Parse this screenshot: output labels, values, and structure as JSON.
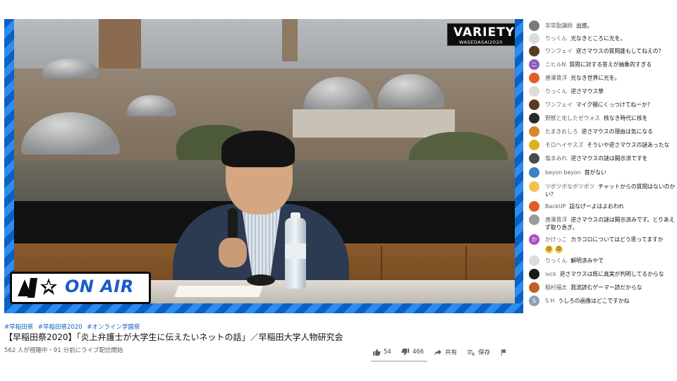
{
  "overlay": {
    "variety_title": "VARIETY",
    "variety_sub": "WASEDASAI2020",
    "onair_label": "ON AIR"
  },
  "video": {
    "tags": [
      "#早稲田祭",
      "#早稲田祭2020",
      "#オンライン学園祭"
    ],
    "title": "【早稲田祭2020】「炎上弁護士が大学生に伝えたいネットの話」／早稲田大学人物研究会",
    "meta": "562 人が視聴中・91 分前にライブ配信開始",
    "like_count": "54",
    "dislike_count": "466",
    "share_label": "共有",
    "save_label": "保存"
  },
  "chat": [
    {
      "author": "非常勤講師",
      "text": "出感。",
      "avatar_color": "#7a7a7a",
      "avatar_icon": "person-photo-icon"
    },
    {
      "author": "りっくん",
      "text": "光なきところに光を。",
      "avatar_color": "#dcdcdc",
      "avatar_icon": "pattern-avatar-icon"
    },
    {
      "author": "ワンフェイ",
      "text": "逆さマウスの質問誰もしてねえの？",
      "avatar_color": "#5a3a22",
      "avatar_icon": "person-photo-icon"
    },
    {
      "author": "ニヒルN",
      "text": "質問に対する答えが抽象的すぎる",
      "avatar_color": "#8e5bc4",
      "avatar_icon": "letter-avatar-icon",
      "avatar_letter": "ニ"
    },
    {
      "author": "唐澤貴洋",
      "text": "光なき世界に光を。",
      "avatar_color": "#e25d2a",
      "avatar_icon": "person-photo-icon"
    },
    {
      "author": "りっくん",
      "text": "逆さマウス草",
      "avatar_color": "#dcdcdc",
      "avatar_icon": "pattern-avatar-icon"
    },
    {
      "author": "ワンフェイ",
      "text": "マイク顎にくっつけてねーか？",
      "avatar_color": "#5a3a22",
      "avatar_icon": "person-photo-icon"
    },
    {
      "author": "野獣と化したゼウォス",
      "text": "核なき時代に核を",
      "avatar_color": "#2a2a2a",
      "avatar_icon": "person-photo-icon"
    },
    {
      "author": "たまきおしろ",
      "text": "逆さマウスの理由は気になる",
      "avatar_color": "#d9862a",
      "avatar_icon": "emoji-avatar-icon"
    },
    {
      "author": "モロヘイヤスズ",
      "text": "そういや逆さマウスの謎あったな",
      "avatar_color": "#e0b020",
      "avatar_icon": "emoji-avatar-icon"
    },
    {
      "author": "塩まみれ",
      "text": "逆さマウスの謎は開示済ですを",
      "avatar_color": "#4a4a4a",
      "avatar_icon": "person-photo-icon"
    },
    {
      "author": "beyon beyon",
      "text": "首がない",
      "avatar_color": "#3b82c4",
      "avatar_icon": "pattern-avatar-icon"
    },
    {
      "author": "ツボツボなボツボツ",
      "text": "チャットからの質問はないのかい？",
      "avatar_color": "#f2c14e",
      "avatar_icon": "emoji-avatar-icon"
    },
    {
      "author": "BackUP",
      "text": "話なげーよはよおわれ",
      "avatar_color": "#e25d2a",
      "avatar_icon": "person-photo-icon"
    },
    {
      "author": "唐澤貴洋",
      "text": "逆さマウスの謎は開示済みです。とりあえず取り急ぎ。",
      "avatar_color": "#9a9a9a",
      "avatar_icon": "person-photo-icon"
    },
    {
      "author": "かけっこ",
      "text": "カラコロについてはどう思ってますか",
      "avatar_color": "#a84fc4",
      "avatar_icon": "letter-avatar-icon",
      "avatar_letter": "か"
    },
    {
      "author": "りっくん",
      "text": "解明済みやで",
      "avatar_color": "#dcdcdc",
      "avatar_icon": "pattern-avatar-icon"
    },
    {
      "author": "ivck",
      "text": "逆さマウスは既に真実が判明してるからな",
      "avatar_color": "#1a1a1a",
      "avatar_icon": "person-photo-icon"
    },
    {
      "author": "稲村福太",
      "text": "我流読むゲーマー読だからな",
      "avatar_color": "#c0602a",
      "avatar_icon": "person-photo-icon"
    },
    {
      "author": "S H",
      "text": "うしろの画像はどこですかね",
      "avatar_color": "#8aa0b4",
      "avatar_icon": "letter-avatar-icon",
      "avatar_letter": "S"
    }
  ],
  "colors": {
    "player_frame": "#1d7fe0",
    "link": "#1565c0"
  }
}
